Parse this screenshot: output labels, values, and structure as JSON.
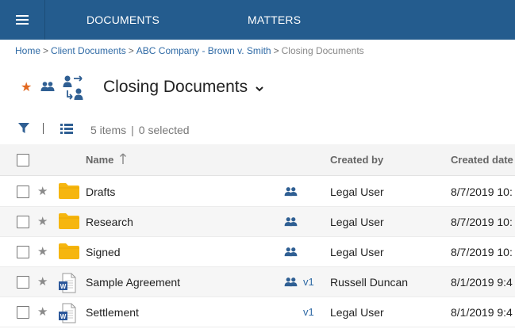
{
  "nav": {
    "menu_icon": "hamburger-icon",
    "tabs": [
      {
        "label": "DOCUMENTS"
      },
      {
        "label": "MATTERS"
      }
    ]
  },
  "breadcrumb": {
    "items": [
      "Home",
      "Client Documents",
      "ABC Company - Brown v. Smith"
    ],
    "separator": ">",
    "current": "Closing Documents"
  },
  "title": {
    "text": "Closing Documents",
    "favorite_icon": "star-icon",
    "shared_icon": "people-icon",
    "workspace_icon": "share-workflow-icon",
    "dropdown_icon": "chevron-down-icon",
    "favorite_color": "#e2681f"
  },
  "toolbar": {
    "filter_icon": "filter-icon",
    "view_icon": "list-view-icon",
    "item_count": "5 items",
    "selected_count": "0 selected"
  },
  "table": {
    "columns": [
      {
        "label": "Name",
        "sort": "ascending"
      },
      {
        "label": "Created by"
      },
      {
        "label": "Created date"
      }
    ],
    "rows": [
      {
        "name": "Drafts",
        "type": "folder",
        "shared": true,
        "version": "",
        "created_by": "Legal User",
        "created_date": "8/7/2019 10:"
      },
      {
        "name": "Research",
        "type": "folder",
        "shared": true,
        "version": "",
        "created_by": "Legal User",
        "created_date": "8/7/2019 10:"
      },
      {
        "name": "Signed",
        "type": "folder",
        "shared": true,
        "version": "",
        "created_by": "Legal User",
        "created_date": "8/7/2019 10:"
      },
      {
        "name": "Sample Agreement",
        "type": "word-document",
        "shared": true,
        "version": "v1",
        "created_by": "Russell Duncan",
        "created_date": "8/1/2019 9:4"
      },
      {
        "name": "Settlement",
        "type": "word-document",
        "shared": false,
        "version": "v1",
        "created_by": "Legal User",
        "created_date": "8/1/2019 9:4"
      }
    ]
  },
  "colors": {
    "topbar": "#245c8e",
    "link": "#2f6aa5",
    "folder": "#f6b60f",
    "icon_blue": "#2f5f93",
    "word_blue": "#2b579a"
  }
}
